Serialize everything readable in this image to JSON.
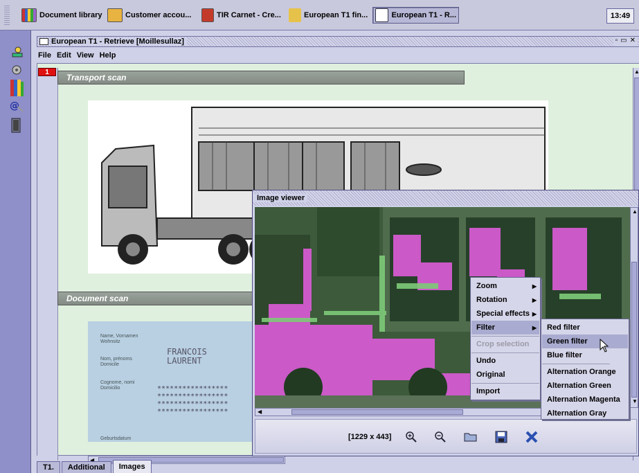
{
  "taskbar": {
    "tasks": [
      {
        "label": "Document library",
        "icon": "library-icon"
      },
      {
        "label": "Customer accou...",
        "icon": "account-icon"
      },
      {
        "label": "TIR Carnet - Cre...",
        "icon": "tir-carnet-icon"
      },
      {
        "label": "European T1 fin...",
        "icon": "search-user-icon"
      },
      {
        "label": "European T1 - R...",
        "icon": "folder-window-icon"
      }
    ],
    "clock": "13:49"
  },
  "launcher": {
    "icons": [
      "user-icon",
      "settings-icon",
      "library-icon",
      "email-icon",
      "door-icon"
    ]
  },
  "window": {
    "title": "European T1 - Retrieve [Moillesullaz]",
    "menu": [
      "File",
      "Edit",
      "View",
      "Help"
    ],
    "row_number": "1",
    "section_transport": "Transport scan",
    "section_document": "Document scan",
    "document": {
      "label_1a": "Name, Vornamen",
      "label_1b": "Wohnsitz",
      "label_2a": "Nom, prénoms",
      "label_2b": "Domicile",
      "label_3a": "Cognome, nomi",
      "label_3b": "Domicilio",
      "label_4": "Geburtsdatum",
      "name_line1": "FRANCOIS",
      "name_line2": "LAURENT",
      "stars_1": "*****************",
      "stars_2": "*****************",
      "stars_3": "*****************",
      "stars_4": "*****************"
    },
    "tabs": [
      "T1.",
      "Additional",
      "Images"
    ],
    "active_tab": "Images"
  },
  "viewer": {
    "title": "Image viewer",
    "dimensions": "[1229 x 443]",
    "toolbar_icons": [
      "zoom-in-icon",
      "zoom-out-icon",
      "open-folder-icon",
      "save-icon",
      "close-icon"
    ]
  },
  "context_menu": {
    "items": [
      {
        "label": "Zoom",
        "submenu": true
      },
      {
        "label": "Rotation",
        "submenu": true
      },
      {
        "label": "Special effects",
        "submenu": true
      },
      {
        "label": "Filter",
        "submenu": true,
        "selected": true
      },
      {
        "label": "Crop selection",
        "disabled": true
      },
      {
        "label": "Undo"
      },
      {
        "label": "Original"
      },
      {
        "label": "Import"
      }
    ],
    "filter_submenu": [
      {
        "label": "Red filter"
      },
      {
        "label": "Green filter",
        "selected": true
      },
      {
        "label": "Blue filter"
      },
      {
        "label": "Alternation Orange"
      },
      {
        "label": "Alternation Green"
      },
      {
        "label": "Alternation Magenta"
      },
      {
        "label": "Alternation Gray"
      }
    ]
  },
  "colors": {
    "desktop": "#8f8fc9",
    "content_bg": "#dff0de",
    "row_marker": "#e01010",
    "filter_magenta": "#d45bd0",
    "filter_green": "#3d5a3b"
  }
}
